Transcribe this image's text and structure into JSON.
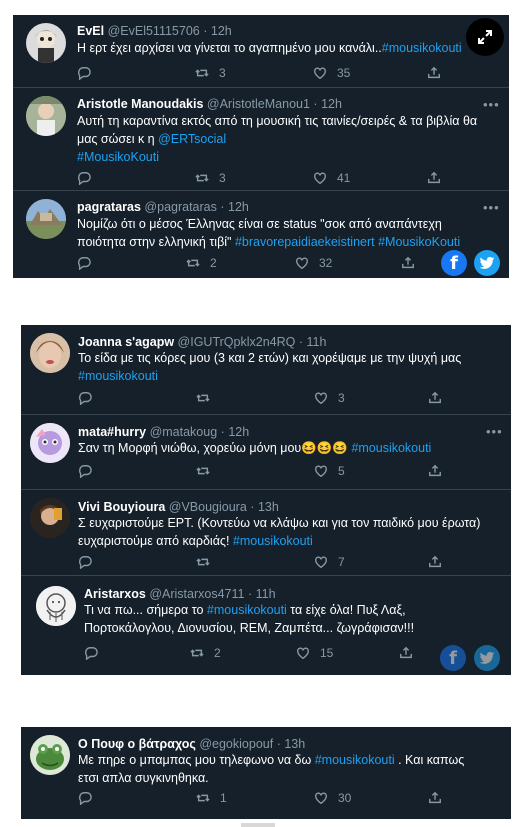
{
  "cards": [
    {
      "tweets": [
        {
          "name": "EvEl",
          "handle": "@EvEl51115706",
          "time": "12h",
          "lines": [
            [
              {
                "t": "Η ερτ έχει αρχίσει να γίνεται το αγαπημένο μου κανάλι..",
                "tag": false
              },
              {
                "t": "#mousikokouti",
                "tag": true
              }
            ]
          ],
          "replies": "",
          "retweets": "3",
          "likes": "35"
        },
        {
          "name": "Aristotle Manoudakis",
          "handle": "@AristotleManou1",
          "time": "12h",
          "lines": [
            [
              {
                "t": "Αυτή τη καραντίνα εκτός από τη μουσική τις ταινίες/σειρές & τα βιβλία θα",
                "tag": false
              }
            ],
            [
              {
                "t": "μας σώσει κ η ",
                "tag": false
              },
              {
                "t": "@ERTsocial",
                "tag": true
              }
            ],
            [
              {
                "t": "#MousikoKouti",
                "tag": true
              }
            ]
          ],
          "replies": "",
          "retweets": "3",
          "likes": "41"
        },
        {
          "name": "pagrataras",
          "handle": "@pagrataras",
          "time": "12h",
          "lines": [
            [
              {
                "t": "Νομίζω ότι ο μέσος Έλληνας είναι σε status \"σοκ από αναπάντεχη",
                "tag": false
              }
            ],
            [
              {
                "t": "ποιότητα στην ελληνική τιβί\" ",
                "tag": false
              },
              {
                "t": "#bravorepaidiaekeistinert",
                "tag": true
              },
              {
                "t": " ",
                "tag": false
              },
              {
                "t": "#MousikoKouti",
                "tag": true
              }
            ]
          ],
          "replies": "",
          "retweets": "2",
          "likes": "32"
        }
      ]
    },
    {
      "tweets": [
        {
          "name": "Joanna s'agapw",
          "handle": "@IGUTrQpklx2n4RQ",
          "time": "11h",
          "lines": [
            [
              {
                "t": "Το είδα με τις κόρες μου (3 και 2 ετών) και χορέψαμε με την ψυχή μας",
                "tag": false
              }
            ],
            [
              {
                "t": "#mousikokouti",
                "tag": true
              }
            ]
          ],
          "replies": "",
          "retweets": "",
          "likes": "3"
        },
        {
          "name": "mata#hurry",
          "handle": "@matakoug",
          "time": "12h",
          "lines": [
            [
              {
                "t": "Σαν τη Μορφή νιώθω, χορεύω μόνη μου",
                "tag": false
              },
              {
                "t": "😆😆😆",
                "tag": false
              },
              {
                "t": " ",
                "tag": false
              },
              {
                "t": "#mousikokouti",
                "tag": true
              }
            ]
          ],
          "replies": "",
          "retweets": "",
          "likes": "5"
        },
        {
          "name": "Vivi Bouyioura",
          "handle": "@VBougioura",
          "time": "13h",
          "lines": [
            [
              {
                "t": "Σ ευχαριστούμε ΕΡΤ. (Κοντεύω να κλάψω και για τον παιδικό μου έρωτα)",
                "tag": false
              }
            ],
            [
              {
                "t": "ευχαριστούμε από καρδιάς! ",
                "tag": false
              },
              {
                "t": "#mousikokouti",
                "tag": true
              }
            ]
          ],
          "replies": "",
          "retweets": "",
          "likes": "7"
        },
        {
          "name": "Aristarxos",
          "handle": "@Aristarxos4711",
          "time": "11h",
          "lines": [
            [
              {
                "t": "Τι να πω... σήμερα το ",
                "tag": false
              },
              {
                "t": "#mousikokouti",
                "tag": true
              },
              {
                "t": " τα είχε όλα! Πυξ Λαξ,",
                "tag": false
              }
            ],
            [
              {
                "t": "Πορτοκάλογλου, Διονυσίου, REM, Ζαμπέτα... ζωγράφισαν!!!",
                "tag": false
              }
            ]
          ],
          "replies": "",
          "retweets": "2",
          "likes": "15"
        }
      ]
    },
    {
      "tweets": [
        {
          "name": "Ο Πουφ ο βάτραχος",
          "handle": "@egokiopouf",
          "time": "13h",
          "lines": [
            [
              {
                "t": "Με πηρε ο μπαμπας μου τηλεφωνο να δω ",
                "tag": false
              },
              {
                "t": "#mousikokouti",
                "tag": true
              },
              {
                "t": " . Και καπως",
                "tag": false
              }
            ],
            [
              {
                "t": "ετσι απλα συγκινηθηκα.",
                "tag": false
              }
            ]
          ],
          "replies": "",
          "retweets": "1",
          "likes": "30"
        }
      ]
    }
  ],
  "dot": "·",
  "more_label": "•••",
  "facebook_label": "f",
  "icons": {
    "reply": "reply-icon",
    "retweet": "retweet-icon",
    "like": "heart-icon",
    "share": "share-icon",
    "facebook": "facebook-icon",
    "twitter": "twitter-bird-icon",
    "expand": "expand-icon"
  },
  "colors": {
    "card_bg": "#15202b",
    "text": "#ffffff",
    "secondary": "#8899a6",
    "link": "#1da1f2",
    "facebook": "#1877f2"
  }
}
